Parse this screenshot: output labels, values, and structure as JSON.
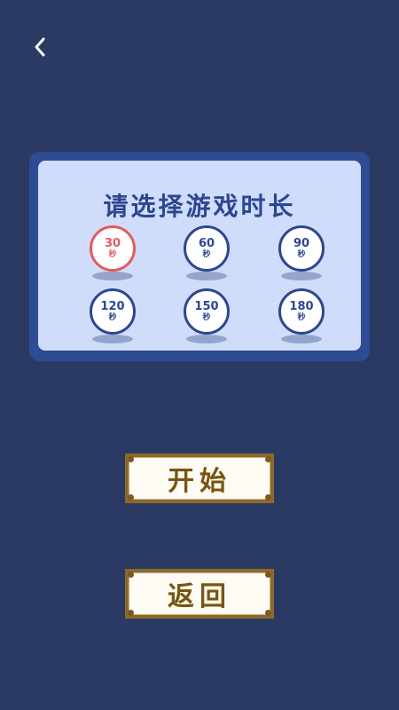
{
  "header": {
    "back_icon": "chevron-left-icon"
  },
  "panel": {
    "title": "请选择游戏时长",
    "selected_index": 0,
    "options": [
      {
        "value": "30",
        "unit": "秒"
      },
      {
        "value": "60",
        "unit": "秒"
      },
      {
        "value": "90",
        "unit": "秒"
      },
      {
        "value": "120",
        "unit": "秒"
      },
      {
        "value": "150",
        "unit": "秒"
      },
      {
        "value": "180",
        "unit": "秒"
      }
    ]
  },
  "buttons": {
    "start_label": "开始",
    "back_label": "返回"
  },
  "colors": {
    "background": "#2b3a63",
    "panel_border": "#2f4b93",
    "panel_fill": "#cfdcfa",
    "accent_blue": "#2d4690",
    "selected_red": "#e45a5f",
    "plaque_frame": "#8b6a2c",
    "plaque_text": "#7a5410"
  }
}
